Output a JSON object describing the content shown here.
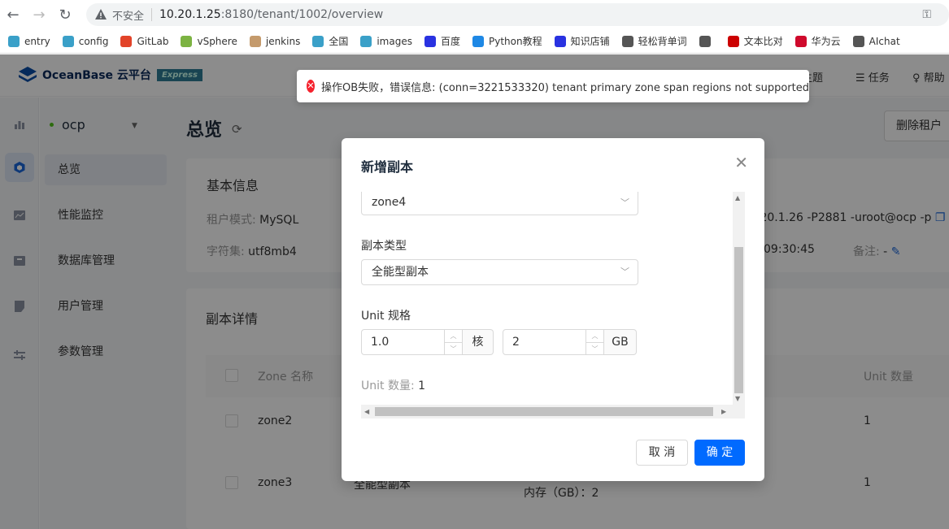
{
  "browser": {
    "insecure_label": "不安全",
    "url_host": "10.20.1.25",
    "url_rest": ":8180/tenant/1002/overview",
    "bookmarks": [
      {
        "label": "entry",
        "color": "#3aa0c8"
      },
      {
        "label": "config",
        "color": "#3aa0c8"
      },
      {
        "label": "GitLab",
        "color": "#e24329"
      },
      {
        "label": "vSphere",
        "color": "#7cb342"
      },
      {
        "label": "jenkins",
        "color": "#c49a6c"
      },
      {
        "label": "全国",
        "color": "#3aa0c8"
      },
      {
        "label": "images",
        "color": "#3aa0c8"
      },
      {
        "label": "百度",
        "color": "#2932e1"
      },
      {
        "label": "Python教程",
        "color": "#1e88e5"
      },
      {
        "label": "知识店铺",
        "color": "#2932e1"
      },
      {
        "label": "轻松背单词",
        "color": "#555555"
      },
      {
        "label": "",
        "color": "#555555"
      },
      {
        "label": "文本比对",
        "color": "#cc0000"
      },
      {
        "label": "华为云",
        "color": "#cf0a2c"
      },
      {
        "label": "AIchat",
        "color": "#555555"
      }
    ]
  },
  "header": {
    "brand": "OceanBase 云平台",
    "edition": "Express",
    "theme_partial": "主题",
    "tasks": "任务",
    "help_partial": "帮助"
  },
  "sidebar": {
    "tenant_name": "ocp",
    "items": [
      {
        "label": "总览",
        "active": true
      },
      {
        "label": "性能监控"
      },
      {
        "label": "数据库管理"
      },
      {
        "label": "用户管理"
      },
      {
        "label": "参数管理"
      }
    ]
  },
  "page": {
    "title": "总览",
    "delete_button": "删除租户",
    "basic_info_title": "基本信息",
    "tenant_mode_label": "租户模式:",
    "tenant_mode_value": "MySQL",
    "charset_label": "字符集:",
    "charset_value": "utf8mb4",
    "connection_partial": ".20.1.26 -P2881 -uroot@ocp -p",
    "time_partial": "09:30:45",
    "remark_label": "备注:",
    "remark_value": "-",
    "replica_title": "副本详情",
    "table_headers": {
      "zone": "Zone 名称",
      "unit_count": "Unit 数量"
    },
    "rows": [
      {
        "zone": "zone2",
        "unit_count": "1"
      },
      {
        "zone": "zone3",
        "unit_count": "1",
        "type_partial": "全能型副本",
        "memory": "内存（GB）：2"
      }
    ]
  },
  "toast": {
    "message": "操作OB失败，错误信息: (conn=3221533320) tenant primary zone span regions not supported"
  },
  "modal": {
    "title": "新增副本",
    "zone_value": "zone4",
    "replica_type_label": "副本类型",
    "replica_type_value": "全能型副本",
    "unit_spec_label": "Unit 规格",
    "cpu_value": "1.0",
    "cpu_unit": "核",
    "mem_value": "2",
    "mem_unit": "GB",
    "unit_count_label": "Unit 数量:",
    "unit_count_value": "1",
    "cancel": "取 消",
    "ok": "确 定"
  }
}
